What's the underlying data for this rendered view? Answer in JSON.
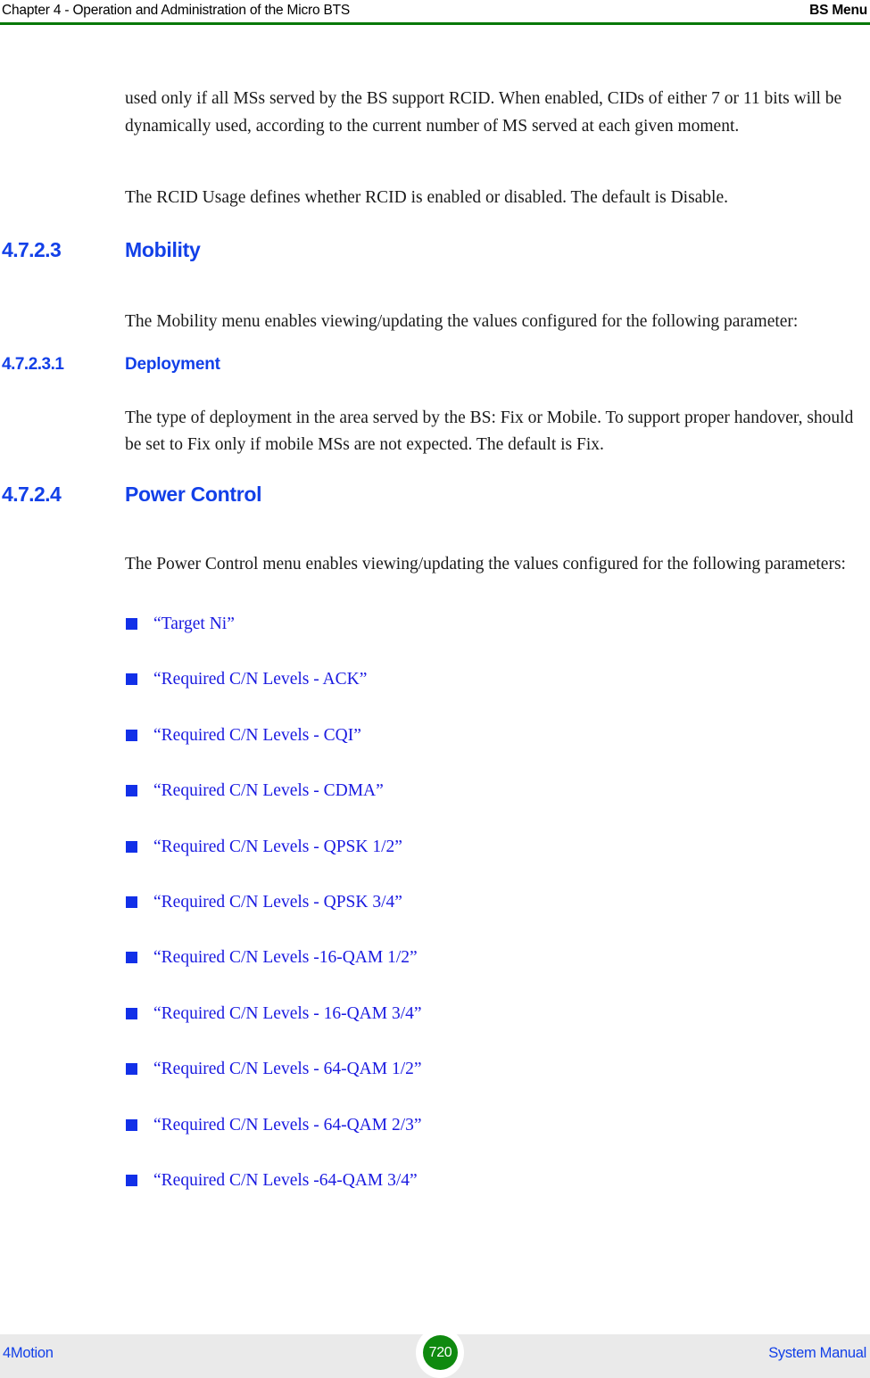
{
  "header": {
    "left": "Chapter 4 - Operation and Administration of the Micro BTS",
    "right": "BS Menu",
    "rule_color": "#087808"
  },
  "colors": {
    "heading_blue": "#1240E8",
    "link_blue": "#1A1AE0",
    "bullet_blue": "#1230E8",
    "rule_green": "#087808",
    "footer_band": "#EAEAEA",
    "page_badge_green": "#0F8A0F"
  },
  "body": {
    "paragraph_1": "used only if all MSs served by the BS support RCID. When enabled, CIDs of either 7 or 11 bits will be dynamically used, according to the current number of MS served at each given moment.",
    "paragraph_2": "The RCID Usage defines whether RCID is enabled or disabled. The default is Disable."
  },
  "sections": [
    {
      "number": "4.7.2.3",
      "title": "Mobility",
      "level": 3,
      "body": "The Mobility menu enables viewing/updating the values configured for the following parameter:"
    },
    {
      "number": "4.7.2.3.1",
      "title": "Deployment",
      "level": 4,
      "body": "The type of deployment in the area served by the BS: Fix or Mobile. To support proper handover, should be set to Fix only if mobile MSs are not expected. The default is Fix."
    },
    {
      "number": "4.7.2.4",
      "title": "Power Control",
      "level": 3,
      "body": "The Power Control menu enables viewing/updating the values configured for the following parameters:"
    }
  ],
  "parameter_links": [
    "“Target Ni”",
    "“Required C/N Levels - ACK”",
    "“Required C/N Levels - CQI”",
    "“Required C/N Levels - CDMA”",
    "“Required C/N Levels - QPSK 1/2”",
    "“Required C/N Levels - QPSK 3/4”",
    "“Required C/N Levels -16-QAM 1/2”",
    "“Required C/N Levels - 16-QAM 3/4”",
    "“Required C/N Levels - 64-QAM 1/2”",
    "“Required C/N Levels - 64-QAM 2/3”",
    "“Required C/N Levels -64-QAM 3/4”"
  ],
  "footer": {
    "left": "4Motion",
    "page_number": "720",
    "right": "System Manual"
  }
}
